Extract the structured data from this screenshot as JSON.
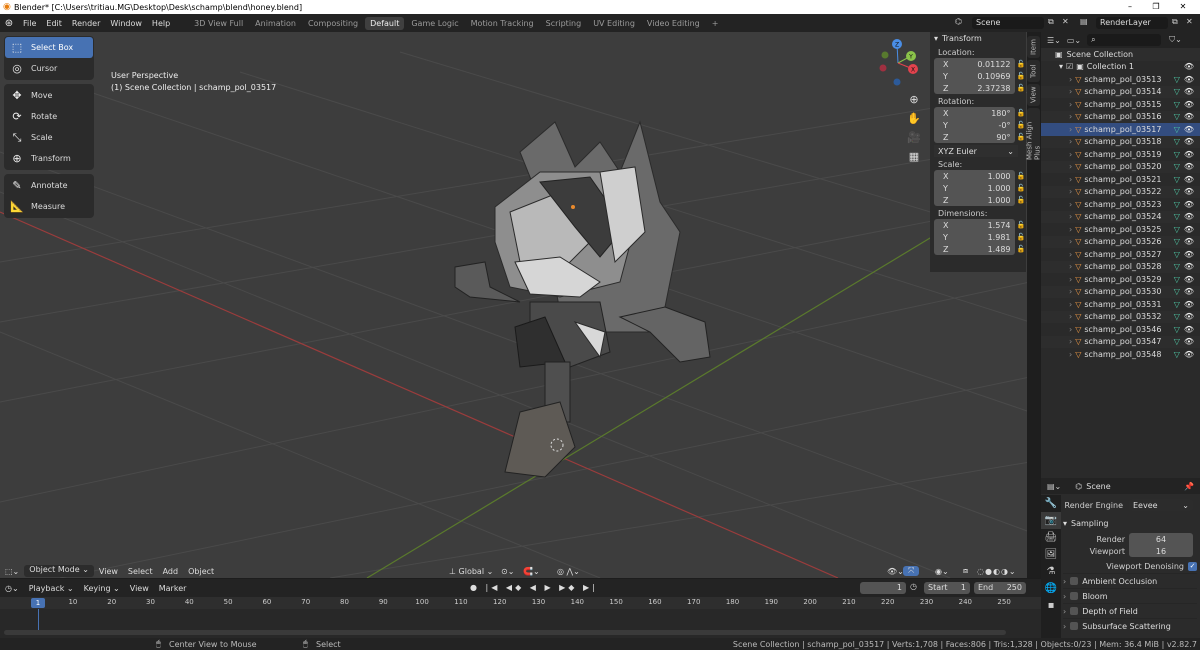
{
  "titlebar": {
    "title": "Blender* [C:\\Users\\tritiau.MG\\Desktop\\Desk\\schamp\\blend\\honey.blend]",
    "minimize": "–",
    "maximize": "❐",
    "close": "✕"
  },
  "menus": [
    "File",
    "Edit",
    "Render",
    "Window",
    "Help"
  ],
  "workspaces": [
    "3D View Full",
    "Animation",
    "Compositing",
    "Default",
    "Game Logic",
    "Motion Tracking",
    "Scripting",
    "UV Editing",
    "Video Editing"
  ],
  "active_workspace": "Default",
  "add_workspace": "+",
  "scene": {
    "name": "Scene",
    "view_layer": "RenderLayer"
  },
  "tools": [
    "Select Box",
    "Cursor",
    "Move",
    "Rotate",
    "Scale",
    "Transform",
    "Annotate",
    "Measure"
  ],
  "viewport": {
    "perspective": "User Perspective",
    "context": "(1) Scene Collection | schamp_pol_03517"
  },
  "gizmo": {
    "z": "Z",
    "y": "Y",
    "x": "X"
  },
  "transform": {
    "title": "Transform",
    "location_label": "Location:",
    "location": [
      {
        "axis": "X",
        "value": "0.01122"
      },
      {
        "axis": "Y",
        "value": "0.10969"
      },
      {
        "axis": "Z",
        "value": "2.37238"
      }
    ],
    "rotation_label": "Rotation:",
    "rotation": [
      {
        "axis": "X",
        "value": "180°"
      },
      {
        "axis": "Y",
        "value": "-0°"
      },
      {
        "axis": "Z",
        "value": "90°"
      }
    ],
    "rotation_mode": "XYZ Euler",
    "scale_label": "Scale:",
    "scale": [
      {
        "axis": "X",
        "value": "1.000"
      },
      {
        "axis": "Y",
        "value": "1.000"
      },
      {
        "axis": "Z",
        "value": "1.000"
      }
    ],
    "dimensions_label": "Dimensions:",
    "dimensions": [
      {
        "axis": "X",
        "value": "1.574"
      },
      {
        "axis": "Y",
        "value": "1.981"
      },
      {
        "axis": "Z",
        "value": "1.489"
      }
    ]
  },
  "side_tabs": [
    "Item",
    "Tool",
    "View",
    "Mesh Align Plus"
  ],
  "viewport_header": {
    "mode": "Object Mode",
    "menus": [
      "View",
      "Select",
      "Add",
      "Object"
    ],
    "orientation": "Global"
  },
  "timeline": {
    "menus": [
      "Playback",
      "Keying",
      "View",
      "Marker"
    ],
    "current_frame": "1",
    "start_label": "Start",
    "start": "1",
    "end_label": "End",
    "end": "250",
    "ticks": [
      "1",
      "10",
      "20",
      "30",
      "40",
      "50",
      "60",
      "70",
      "80",
      "90",
      "100",
      "110",
      "120",
      "130",
      "140",
      "150",
      "160",
      "170",
      "180",
      "190",
      "200",
      "210",
      "220",
      "230",
      "240",
      "250"
    ]
  },
  "statusbar": {
    "left1": "Center View to Mouse",
    "left2": "Select",
    "stats": "Scene Collection | schamp_pol_03517 | Verts:1,708 | Faces:806 | Tris:1,328 | Objects:0/23 | Mem: 36.4 MiB | v2.82.7"
  },
  "outliner": {
    "root": "Scene Collection",
    "collection": "Collection 1",
    "objects": [
      "schamp_pol_03513",
      "schamp_pol_03514",
      "schamp_pol_03515",
      "schamp_pol_03516",
      "schamp_pol_03517",
      "schamp_pol_03518",
      "schamp_pol_03519",
      "schamp_pol_03520",
      "schamp_pol_03521",
      "schamp_pol_03522",
      "schamp_pol_03523",
      "schamp_pol_03524",
      "schamp_pol_03525",
      "schamp_pol_03526",
      "schamp_pol_03527",
      "schamp_pol_03528",
      "schamp_pol_03529",
      "schamp_pol_03530",
      "schamp_pol_03531",
      "schamp_pol_03532",
      "schamp_pol_03546",
      "schamp_pol_03547",
      "schamp_pol_03548"
    ],
    "active": "schamp_pol_03517"
  },
  "properties": {
    "context": "Scene",
    "render_engine_label": "Render Engine",
    "render_engine": "Eevee",
    "sampling": "Sampling",
    "render_label": "Render",
    "render_samples": "64",
    "viewport_label": "Viewport",
    "viewport_samples": "16",
    "denoise": "Viewport Denoising",
    "sections": [
      "Ambient Occlusion",
      "Bloom",
      "Depth of Field",
      "Subsurface Scattering"
    ]
  },
  "colors": {
    "accent": "#4772b3",
    "x_axis": "#e3424d",
    "y_axis": "#8bc34a",
    "z_axis": "#4a8ee6",
    "object_orange": "#f19a45"
  }
}
